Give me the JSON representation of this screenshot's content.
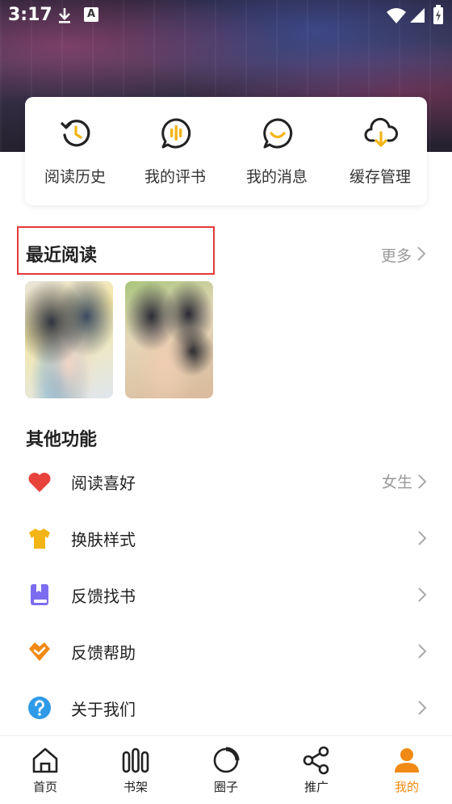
{
  "status_bar": {
    "time": "3:17",
    "a_badge": "A"
  },
  "quick_actions": [
    {
      "label": "阅读历史",
      "icon": "history-icon"
    },
    {
      "label": "我的评书",
      "icon": "comment-icon"
    },
    {
      "label": "我的消息",
      "icon": "message-icon"
    },
    {
      "label": "缓存管理",
      "icon": "cloud-download-icon"
    }
  ],
  "recent": {
    "title": "最近阅读",
    "more_label": "更多"
  },
  "other": {
    "title": "其他功能",
    "items": [
      {
        "label": "阅读喜好",
        "value": "女生",
        "icon": "heart-icon",
        "color": "#e8433b"
      },
      {
        "label": "换肤样式",
        "value": "",
        "icon": "shirt-icon",
        "color": "#f3b516"
      },
      {
        "label": "反馈找书",
        "value": "",
        "icon": "book-icon",
        "color": "#7b6cf0"
      },
      {
        "label": "反馈帮助",
        "value": "",
        "icon": "handshake-icon",
        "color": "#f08a14"
      },
      {
        "label": "关于我们",
        "value": "",
        "icon": "question-icon",
        "color": "#2f9be8"
      }
    ]
  },
  "bottom_nav": [
    {
      "label": "首页",
      "icon": "home-icon",
      "active": false
    },
    {
      "label": "书架",
      "icon": "bookshelf-icon",
      "active": false
    },
    {
      "label": "圈子",
      "icon": "circle-icon",
      "active": false
    },
    {
      "label": "推广",
      "icon": "share-icon",
      "active": false
    },
    {
      "label": "我的",
      "icon": "profile-icon",
      "active": true
    }
  ],
  "colors": {
    "accent": "#f08a14",
    "accent_yellow": "#f3b516",
    "highlight_box": "#e23a3a",
    "muted_text": "#999999"
  }
}
